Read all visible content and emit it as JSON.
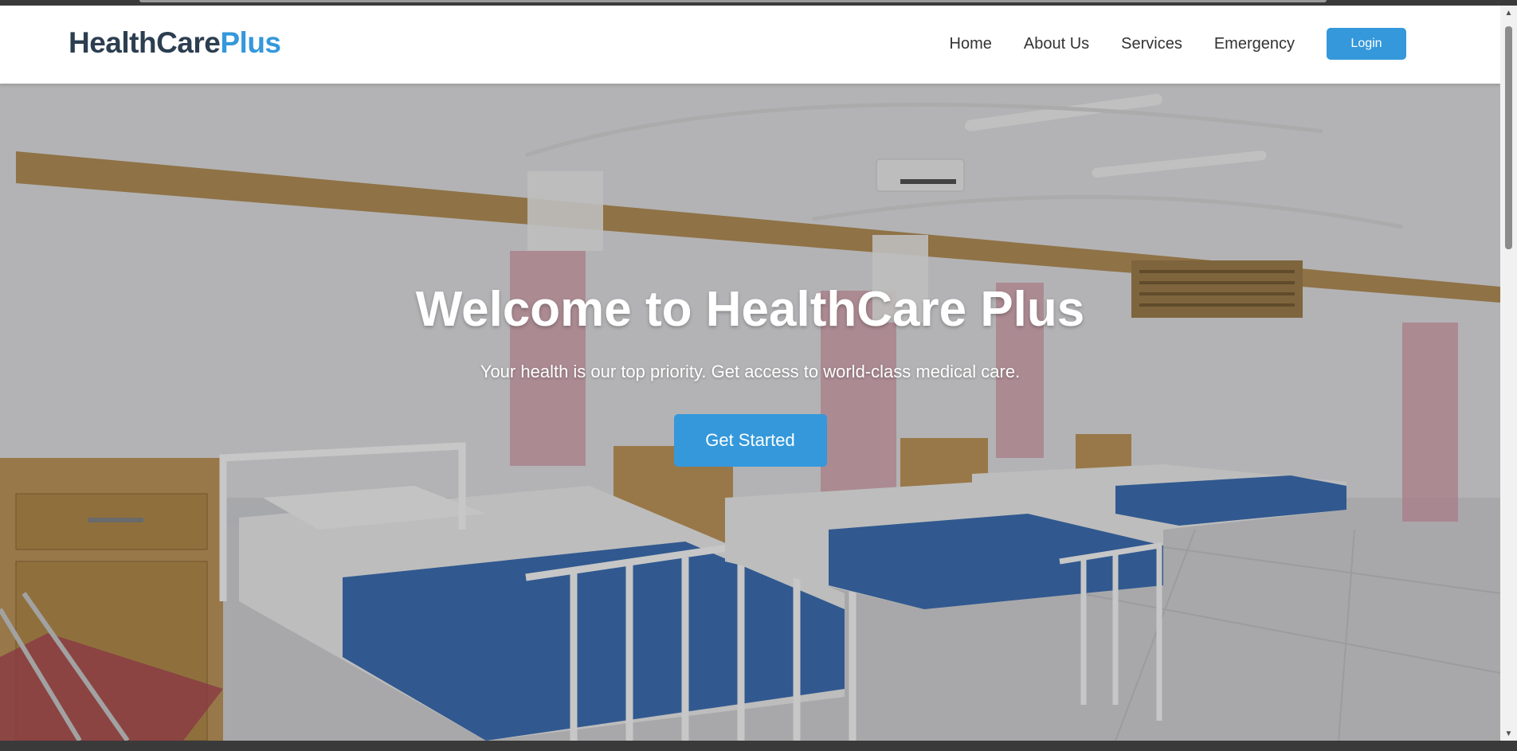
{
  "navbar": {
    "logo_main": "HealthCare",
    "logo_accent": "Plus",
    "links": [
      {
        "label": "Home"
      },
      {
        "label": "About Us"
      },
      {
        "label": "Services"
      },
      {
        "label": "Emergency"
      }
    ],
    "login_label": "Login"
  },
  "hero": {
    "title": "Welcome to HealthCare Plus",
    "subtitle": "Your health is our top priority. Get access to world-class medical care.",
    "cta_label": "Get Started",
    "background_icon": "hospital-ward-photo"
  },
  "colors": {
    "brand_dark": "#2c3e50",
    "accent": "#3498db",
    "nav_text": "#333333"
  }
}
